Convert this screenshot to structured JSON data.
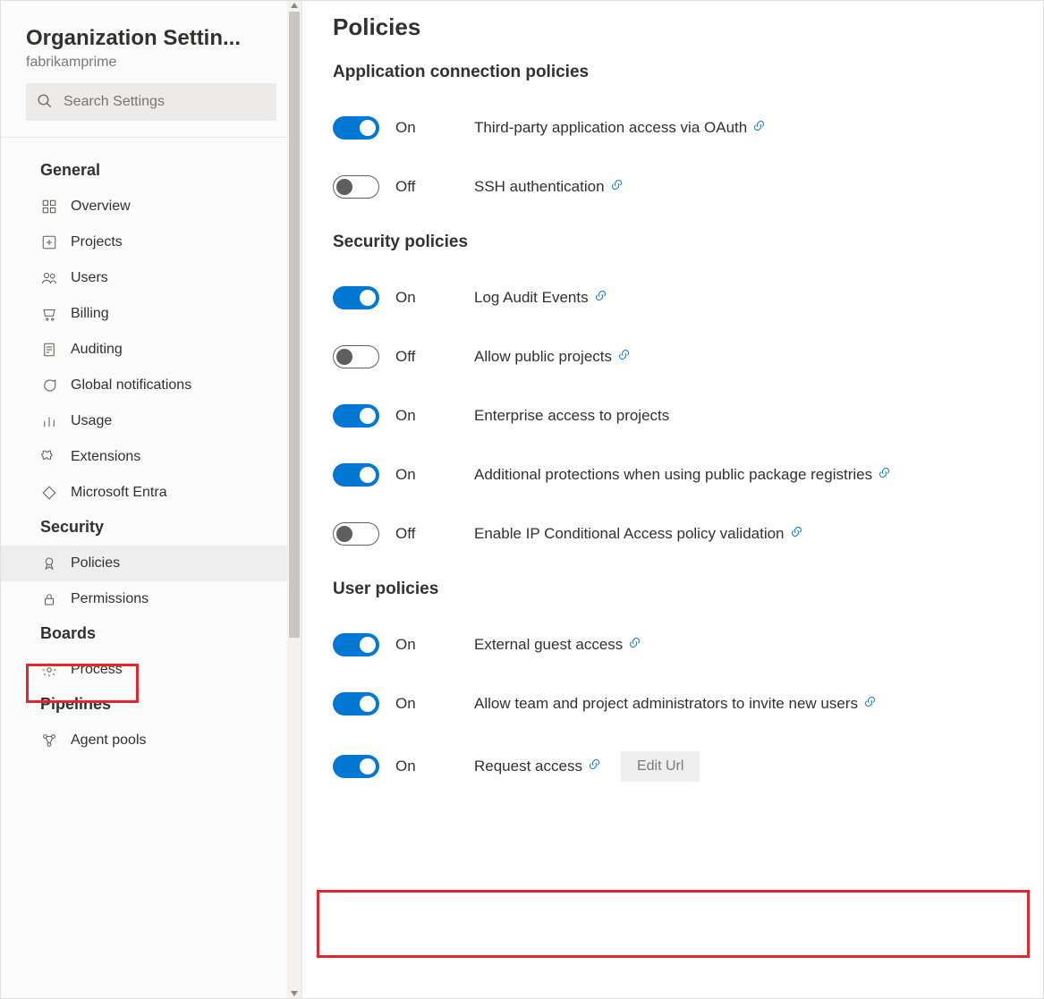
{
  "sidebar": {
    "title": "Organization Settin...",
    "subtitle": "fabrikamprime",
    "search_placeholder": "Search Settings",
    "sections": [
      {
        "title": "General",
        "items": [
          {
            "label": "Overview",
            "icon": "grid-icon"
          },
          {
            "label": "Projects",
            "icon": "plus-box-icon"
          },
          {
            "label": "Users",
            "icon": "users-icon"
          },
          {
            "label": "Billing",
            "icon": "cart-icon"
          },
          {
            "label": "Auditing",
            "icon": "receipt-icon"
          },
          {
            "label": "Global notifications",
            "icon": "chat-icon"
          },
          {
            "label": "Usage",
            "icon": "chart-icon"
          },
          {
            "label": "Extensions",
            "icon": "puzzle-icon"
          },
          {
            "label": "Microsoft Entra",
            "icon": "entra-icon"
          }
        ]
      },
      {
        "title": "Security",
        "items": [
          {
            "label": "Policies",
            "icon": "badge-icon",
            "selected": true
          },
          {
            "label": "Permissions",
            "icon": "lock-icon"
          }
        ]
      },
      {
        "title": "Boards",
        "items": [
          {
            "label": "Process",
            "icon": "gear-icon"
          }
        ]
      },
      {
        "title": "Pipelines",
        "items": [
          {
            "label": "Agent pools",
            "icon": "pool-icon"
          }
        ]
      }
    ]
  },
  "main": {
    "title": "Policies",
    "groups": [
      {
        "title": "Application connection policies",
        "policies": [
          {
            "state": "On",
            "on": true,
            "desc": "Third-party application access via OAuth",
            "link": true
          },
          {
            "state": "Off",
            "on": false,
            "desc": "SSH authentication",
            "link": true
          }
        ]
      },
      {
        "title": "Security policies",
        "policies": [
          {
            "state": "On",
            "on": true,
            "desc": "Log Audit Events",
            "link": true
          },
          {
            "state": "Off",
            "on": false,
            "desc": "Allow public projects",
            "link": true
          },
          {
            "state": "On",
            "on": true,
            "desc": "Enterprise access to projects",
            "link": false
          },
          {
            "state": "On",
            "on": true,
            "desc": "Additional protections when using public package registries",
            "link": true
          },
          {
            "state": "Off",
            "on": false,
            "desc": "Enable IP Conditional Access policy validation",
            "link": true
          }
        ]
      },
      {
        "title": "User policies",
        "policies": [
          {
            "state": "On",
            "on": true,
            "desc": "External guest access",
            "link": true
          },
          {
            "state": "On",
            "on": true,
            "desc": "Allow team and project administrators to invite new users",
            "link": true
          },
          {
            "state": "On",
            "on": true,
            "desc": "Request access",
            "link": true,
            "edit_label": "Edit Url"
          }
        ]
      }
    ]
  }
}
